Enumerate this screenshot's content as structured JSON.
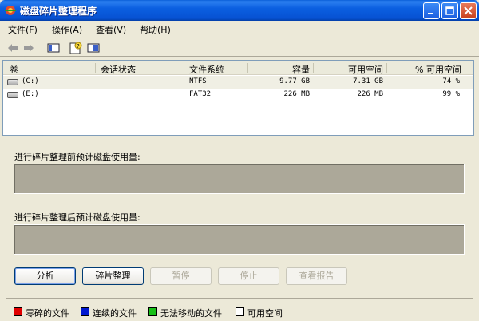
{
  "window": {
    "title": "磁盘碎片整理程序"
  },
  "menu": [
    {
      "label": "文件(F)"
    },
    {
      "label": "操作(A)"
    },
    {
      "label": "查看(V)"
    },
    {
      "label": "帮助(H)"
    }
  ],
  "toolbar": {
    "icons": [
      "back-arrow-icon",
      "forward-arrow-icon",
      "console-tree-icon",
      "help-icon",
      "properties-icon"
    ]
  },
  "volumes": {
    "columns": [
      "卷",
      "会话状态",
      "文件系统",
      "容量",
      "可用空间",
      "% 可用空间"
    ],
    "rows": [
      {
        "volume": "(C:)",
        "status": "",
        "fs": "NTFS",
        "capacity": "9.77 GB",
        "free": "7.31 GB",
        "pct": "74 %"
      },
      {
        "volume": "(E:)",
        "status": "",
        "fs": "FAT32",
        "capacity": "226 MB",
        "free": "226 MB",
        "pct": "99 %"
      }
    ]
  },
  "panels": {
    "before_label": "进行碎片整理前预计磁盘使用量:",
    "after_label": "进行碎片整理后预计磁盘使用量:"
  },
  "buttons": {
    "analyze": "分析",
    "defragment": "碎片整理",
    "pause": "暂停",
    "stop": "停止",
    "view_report": "查看报告"
  },
  "legend": [
    {
      "label": "零碎的文件",
      "color": "#e00000"
    },
    {
      "label": "连续的文件",
      "color": "#0018d0"
    },
    {
      "label": "无法移动的文件",
      "color": "#18c018"
    },
    {
      "label": "可用空间",
      "color": "#ffffff"
    }
  ]
}
